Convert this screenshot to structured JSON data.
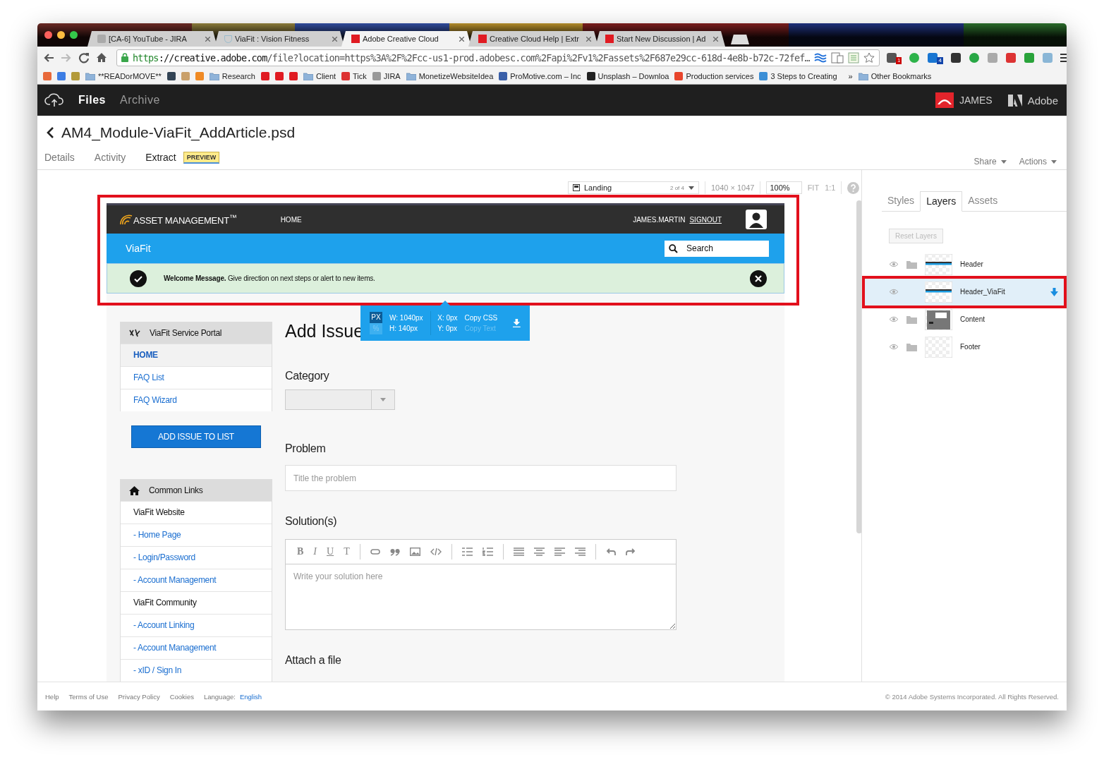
{
  "browser": {
    "tabs": [
      {
        "title": "[CA-6] YouTube - JIRA",
        "kind": "jira",
        "selected": false
      },
      {
        "title": "ViaFit : Vision Fitness",
        "kind": "shield",
        "selected": false
      },
      {
        "title": "Adobe Creative Cloud",
        "kind": "adobe",
        "selected": true
      },
      {
        "title": "Creative Cloud Help | Extr",
        "kind": "adobe",
        "selected": false
      },
      {
        "title": "Start New Discussion | Ad",
        "kind": "adobe",
        "selected": false
      }
    ],
    "url_scheme": "https",
    "url_host": "://creative.adobe.com",
    "url_path": "/file?location=https%3A%2F%2Fcc-us1-prod.adobesc.com%2Fapi%2Fv1%2Fassets%2F687e29cc-618d-4e8b-b72c-72fef…",
    "extensions": [
      {
        "kind": "bell",
        "badge": "1"
      },
      {
        "kind": "leaf"
      },
      {
        "kind": "phone",
        "badge": "4"
      },
      {
        "kind": "gear"
      },
      {
        "kind": "ring"
      },
      {
        "kind": "square"
      },
      {
        "kind": "book"
      },
      {
        "kind": "check"
      },
      {
        "kind": "camera"
      }
    ],
    "bookmarks": [
      {
        "kind": "flag"
      },
      {
        "kind": "google"
      },
      {
        "kind": "books"
      },
      {
        "kind": "folder",
        "label": "**READorMOVE**"
      },
      {
        "kind": "cloud"
      },
      {
        "kind": "figure"
      },
      {
        "kind": "h"
      },
      {
        "kind": "folder",
        "label": "Research"
      },
      {
        "kind": "adobe"
      },
      {
        "kind": "adp"
      },
      {
        "kind": "adobe"
      },
      {
        "kind": "folder",
        "label": "Client"
      },
      {
        "kind": "tick",
        "label": "Tick"
      },
      {
        "kind": "jira",
        "label": "JIRA"
      },
      {
        "kind": "folder",
        "label": "MonetizeWebsiteIdea"
      },
      {
        "kind": "chat",
        "label": "ProMotive.com – Inc"
      },
      {
        "kind": "camera",
        "label": "Unsplash – Downloa"
      },
      {
        "kind": "puzzle",
        "label": "Production services"
      },
      {
        "kind": "people",
        "label": "3 Steps to Creating"
      }
    ],
    "more_bookmarks": "»",
    "other_bookmarks": "Other Bookmarks"
  },
  "app_header": {
    "nav": [
      {
        "label": "Files",
        "selected": true
      },
      {
        "label": "Archive",
        "selected": false
      }
    ],
    "user": "JAMES",
    "brand": "Adobe"
  },
  "file_title": "AM4_Module-ViaFit_AddArticle.psd",
  "subtabs": [
    {
      "label": "Details",
      "selected": false
    },
    {
      "label": "Activity",
      "selected": false
    },
    {
      "label": "Extract",
      "selected": true,
      "badge": "PREVIEW"
    }
  ],
  "actions": [
    "Share",
    "Actions"
  ],
  "canvas_toolbar": {
    "artboard": "Landing",
    "artboard_count": "2 of 4",
    "dimensions": "1040 × 1047",
    "zoom": "100%",
    "fit": "FIT",
    "actual": "1:1"
  },
  "preview": {
    "highlighted": true,
    "header": {
      "logo": "ASSET MANAGEMENT$^{™}$",
      "nav": "HOME",
      "user": "JAMES.MARTIN",
      "signout": "SIGNOUT"
    },
    "bar": {
      "brand": "ViaFit",
      "search_placeholder": "Search"
    },
    "alert": "**Welcome Message.** Give direction on next steps or alert to new items.",
    "sidebar": [
      {
        "title": "ViaFit Service Portal",
        "kind": "tools",
        "items": [
          {
            "label": "HOME",
            "kind": "link",
            "selected": true
          },
          {
            "label": "FAQ List",
            "kind": "link",
            "selected": false
          },
          {
            "label": "FAQ Wizard",
            "kind": "link",
            "selected": false
          }
        ]
      },
      {
        "title": "Common Links",
        "kind": "home",
        "items": [
          {
            "label": "ViaFit Website",
            "kind": "section",
            "selected": false
          },
          {
            "label": "- Home Page",
            "kind": "link",
            "selected": false
          },
          {
            "label": "- Login/Password",
            "kind": "link",
            "selected": false
          },
          {
            "label": "- Account Management",
            "kind": "link",
            "selected": false
          },
          {
            "label": "ViaFit Community",
            "kind": "section",
            "selected": false
          },
          {
            "label": "- Account Linking",
            "kind": "link",
            "selected": false
          },
          {
            "label": "- Account Management",
            "kind": "link",
            "selected": false
          },
          {
            "label": "- xID / Sign In",
            "kind": "link",
            "selected": false
          }
        ]
      }
    ],
    "add_button": "ADD ISSUE TO LIST",
    "form": {
      "title": "Add Issue",
      "category_label": "Category",
      "problem_label": "Problem",
      "problem_placeholder": "Title the problem",
      "solution_label": "Solution(s)",
      "editor_letters": [
        "B",
        "I",
        "U",
        "T"
      ],
      "solution_placeholder": "Write your solution here",
      "attach_label": "Attach a file"
    }
  },
  "measure": {
    "units": [
      {
        "label": "PX",
        "selected": true
      },
      {
        "label": "%",
        "selected": false
      }
    ],
    "w": "W: 1040px",
    "h": "H: 140px",
    "x": "X: 0px",
    "y": "Y: 0px",
    "actions": [
      {
        "label": "Copy CSS",
        "disabled": false
      },
      {
        "label": "Copy Text",
        "disabled": true
      }
    ]
  },
  "panel": {
    "tabs": [
      {
        "label": "Styles",
        "selected": false
      },
      {
        "label": "Layers",
        "selected": true
      },
      {
        "label": "Assets",
        "selected": false
      }
    ],
    "reset": {
      "label": "Reset Layers",
      "disabled": true
    },
    "layers": [
      {
        "name": "Header",
        "folder": true,
        "kind": "header",
        "selected": false,
        "highlighted": false
      },
      {
        "name": "Header_ViaFit",
        "folder": false,
        "kind": "header",
        "selected": true,
        "highlighted": true
      },
      {
        "name": "Content",
        "folder": true,
        "kind": "content",
        "selected": false,
        "highlighted": false
      },
      {
        "name": "Footer",
        "folder": true,
        "kind": "blank",
        "selected": false,
        "highlighted": false
      }
    ]
  },
  "footer": {
    "links": [
      "Help",
      "Terms of Use",
      "Privacy Policy",
      "Cookies"
    ],
    "language_label": "Language:",
    "language": "English",
    "copyright": "© 2014 Adobe Systems Incorporated. All Rights Reserved."
  }
}
